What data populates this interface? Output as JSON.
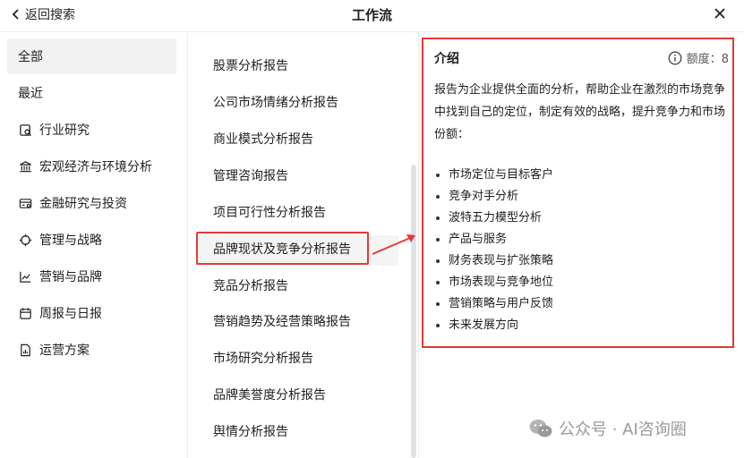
{
  "header": {
    "back_label": "返回搜索",
    "title": "工作流",
    "close_icon": "close-icon"
  },
  "sidebar": {
    "items": [
      {
        "label": "全部",
        "icon": null
      },
      {
        "label": "最近",
        "icon": null
      },
      {
        "label": "行业研究",
        "icon": "search-doc-icon"
      },
      {
        "label": "宏观经济与环境分析",
        "icon": "bank-icon"
      },
      {
        "label": "金融研究与投资",
        "icon": "finance-card-icon"
      },
      {
        "label": "管理与战略",
        "icon": "target-icon"
      },
      {
        "label": "营销与品牌",
        "icon": "trend-chart-icon"
      },
      {
        "label": "周报与日报",
        "icon": "calendar-icon"
      },
      {
        "label": "运营方案",
        "icon": "report-doc-icon"
      }
    ]
  },
  "middle": {
    "items": [
      "股票分析报告",
      "公司市场情绪分析报告",
      "商业模式分析报告",
      "管理咨询报告",
      "项目可行性分析报告",
      "品牌现状及竞争分析报告",
      "竞品分析报告",
      "营销趋势及经营策略报告",
      "市场研究分析报告",
      "品牌美誉度分析报告",
      "舆情分析报告"
    ]
  },
  "detail": {
    "title": "介绍",
    "quota_label": "额度：8",
    "description": "报告为企业提供全面的分析，帮助企业在激烈的市场竞争中找到自己的定位，制定有效的战略，提升竞争力和市场份额：",
    "bullets": [
      "市场定位与目标客户",
      "竞争对手分析",
      "波特五力模型分析",
      "产品与服务",
      "财务表现与扩张策略",
      "市场表现与竞争地位",
      "营销策略与用户反馈",
      "未来发展方向"
    ]
  },
  "watermark": {
    "text": "公众号 · AI咨询圈"
  },
  "colors": {
    "highlight_red": "#e53935",
    "active_bg": "#f2f2f2"
  }
}
